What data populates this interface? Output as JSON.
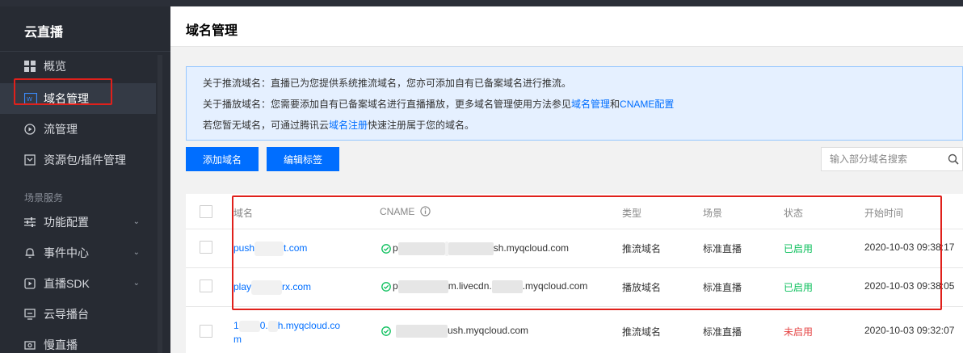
{
  "sidebar": {
    "title": "云直播",
    "items": [
      {
        "label": "概览",
        "icon": "grid-icon"
      },
      {
        "label": "域名管理",
        "icon": "domain-icon"
      },
      {
        "label": "流管理",
        "icon": "play-circle-icon"
      },
      {
        "label": "资源包/插件管理",
        "icon": "package-icon"
      }
    ],
    "section_label": "场景服务",
    "section_items": [
      {
        "label": "功能配置",
        "icon": "sliders-icon"
      },
      {
        "label": "事件中心",
        "icon": "bell-icon"
      },
      {
        "label": "直播SDK",
        "icon": "play-box-icon"
      },
      {
        "label": "云导播台",
        "icon": "monitor-icon"
      },
      {
        "label": "慢直播",
        "icon": "camera-icon"
      }
    ]
  },
  "header": {
    "title": "域名管理"
  },
  "notice": {
    "line1": "关于推流域名：直播已为您提供系统推流域名，您亦可添加自有已备案域名进行推流。",
    "line2_prefix": "关于播放域名：您需要添加自有已备案域名进行直播播放，更多域名管理使用方法参见",
    "line2_link1": "域名管理",
    "line2_and": "和",
    "line2_link2": "CNAME配置",
    "line3_prefix": "若您暂无域名，可通过腾讯云",
    "line3_link": "域名注册",
    "line3_suffix": "快速注册属于您的域名。"
  },
  "toolbar": {
    "add_label": "添加域名",
    "edit_label": "编辑标签",
    "search_placeholder": "输入部分域名搜索"
  },
  "table": {
    "headers": {
      "domain": "域名",
      "cname": "CNAME",
      "type": "类型",
      "scene": "场景",
      "status": "状态",
      "start": "开始时间"
    },
    "rows": [
      {
        "domain_a": "push",
        "domain_b": "t.com",
        "cname_a": "p",
        "cname_b": "sh.myqcloud.com",
        "type": "推流域名",
        "scene": "标准直播",
        "status": "已启用",
        "start": "2020-10-03 09:38:17"
      },
      {
        "domain_a": "play",
        "domain_b": "rx.com",
        "cname_a": "p",
        "cname_b": "m.livecdn.",
        "cname_c": ".myqcloud.com",
        "type": "播放域名",
        "scene": "标准直播",
        "status": "已启用",
        "start": "2020-10-03 09:38:05"
      },
      {
        "domain_a": "1",
        "domain_b": "0.",
        "domain_c": "h.myqcloud.co",
        "domain_d": "m",
        "cname_b": "ush.myqcloud.com",
        "type": "推流域名",
        "scene": "标准直播",
        "status": "未启用",
        "start": "2020-10-03 09:32:07"
      }
    ]
  },
  "colors": {
    "accent": "#006eff",
    "enabled": "#0abf5b",
    "disabled": "#e54545",
    "highlight": "#e0201b"
  }
}
